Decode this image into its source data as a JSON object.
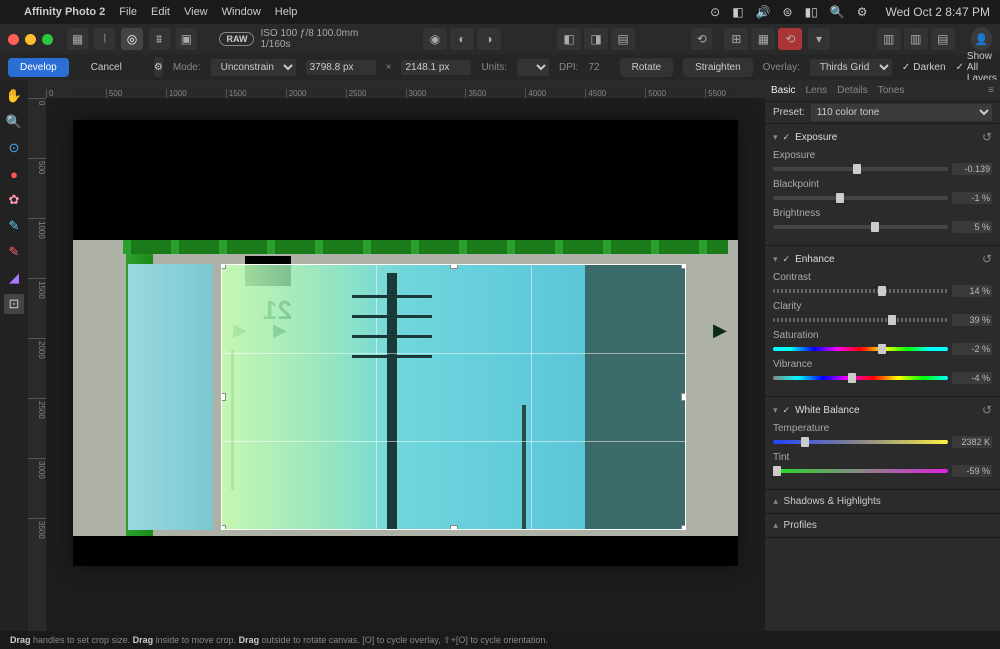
{
  "menubar": {
    "app": "Affinity Photo 2",
    "items": [
      "File",
      "Edit",
      "View",
      "Window",
      "Help"
    ],
    "clock": "Wed Oct 2  8:47 PM"
  },
  "traffic": {
    "close": "#ff5f57",
    "min": "#febc2e",
    "max": "#28c840"
  },
  "toolbar": {
    "raw_badge": "RAW",
    "meta": "ISO 100 ƒ/8 100.0mm 1/160s"
  },
  "contextbar": {
    "develop": "Develop",
    "cancel": "Cancel",
    "mode_label": "Mode:",
    "mode_value": "Unconstrained",
    "width": "3798.8 px",
    "x_sep": "×",
    "height": "2148.1 px",
    "units_label": "Units:",
    "dpi_label": "DPI:",
    "dpi_value": "72",
    "rotate": "Rotate",
    "straighten": "Straighten",
    "overlay_label": "Overlay:",
    "overlay_value": "Thirds Grid",
    "darken": "Darken",
    "show_all": "Show All Layers"
  },
  "ruler_h": [
    "0",
    "500",
    "1000",
    "1500",
    "2000",
    "2500",
    "3000",
    "3500",
    "4000",
    "4500",
    "5000",
    "5500"
  ],
  "ruler_v": [
    "0",
    "500",
    "1000",
    "1500",
    "2000",
    "2500",
    "3000",
    "3500"
  ],
  "frame_number": "21",
  "panel": {
    "tabs": [
      "Basic",
      "Lens",
      "Details",
      "Tones"
    ],
    "preset_label": "Preset:",
    "preset_value": "110 color tone",
    "exposure": {
      "title": "Exposure",
      "rows": [
        {
          "label": "Exposure",
          "value": "-0.139",
          "pos": 48
        },
        {
          "label": "Blackpoint",
          "value": "-1 %",
          "pos": 38
        },
        {
          "label": "Brightness",
          "value": "5 %",
          "pos": 58
        }
      ]
    },
    "enhance": {
      "title": "Enhance",
      "rows": [
        {
          "label": "Contrast",
          "value": "14 %",
          "pos": 62,
          "dotted": true
        },
        {
          "label": "Clarity",
          "value": "39 %",
          "pos": 68,
          "dotted": true
        },
        {
          "label": "Saturation",
          "value": "-2 %",
          "pos": 62,
          "grad": "sat"
        },
        {
          "label": "Vibrance",
          "value": "-4 %",
          "pos": 45,
          "grad": "vib"
        }
      ]
    },
    "wb": {
      "title": "White Balance",
      "rows": [
        {
          "label": "Temperature",
          "value": "2382 K",
          "pos": 18,
          "grad": "temp"
        },
        {
          "label": "Tint",
          "value": "-59 %",
          "pos": 2,
          "grad": "tint"
        }
      ]
    },
    "shadows": "Shadows & Highlights",
    "profiles": "Profiles"
  },
  "statusbar": {
    "text_pre1": "Drag",
    "text1": " handles to set crop size. ",
    "text_pre2": "Drag",
    "text2": " inside to move crop. ",
    "text_pre3": "Drag",
    "text3": " outside to rotate canvas. [O] to cycle overlay, ⇧+[O] to cycle orientation."
  }
}
